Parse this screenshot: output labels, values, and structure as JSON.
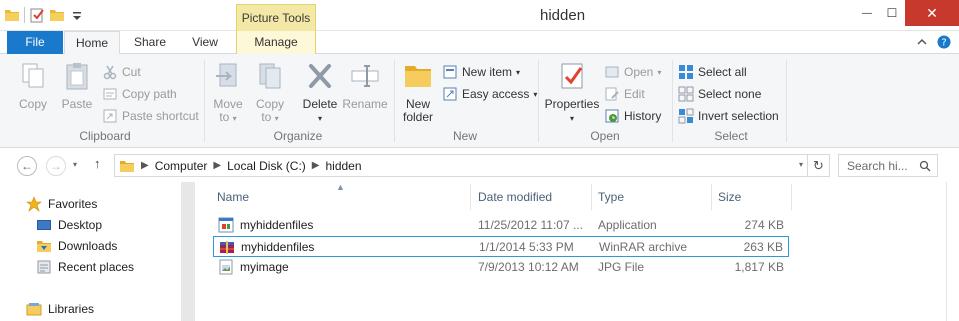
{
  "window": {
    "title": "hidden",
    "contextual_tab": "Picture Tools",
    "close_glyph": "✕",
    "minimize_glyph": "—",
    "maximize_glyph": "☐"
  },
  "tabs": {
    "file": "File",
    "home": "Home",
    "share": "Share",
    "view": "View",
    "manage": "Manage"
  },
  "ribbon": {
    "clipboard": {
      "label": "Clipboard",
      "copy": "Copy",
      "paste": "Paste",
      "cut": "Cut",
      "copy_path": "Copy path",
      "paste_shortcut": "Paste shortcut"
    },
    "organize": {
      "label": "Organize",
      "move_to_1": "Move",
      "move_to_2": "to",
      "copy_to_1": "Copy",
      "copy_to_2": "to",
      "delete": "Delete",
      "rename": "Rename"
    },
    "new": {
      "label": "New",
      "new_folder_1": "New",
      "new_folder_2": "folder",
      "new_item": "New item",
      "easy_access": "Easy access"
    },
    "open": {
      "label": "Open",
      "properties": "Properties",
      "open": "Open",
      "edit": "Edit",
      "history": "History"
    },
    "select": {
      "label": "Select",
      "select_all": "Select all",
      "select_none": "Select none",
      "invert_selection": "Invert selection"
    }
  },
  "address": {
    "segments": [
      "Computer",
      "Local Disk (C:)",
      "hidden"
    ],
    "search_placeholder": "Search hi..."
  },
  "navpane": {
    "favorites": "Favorites",
    "desktop": "Desktop",
    "downloads": "Downloads",
    "recent": "Recent places",
    "libraries": "Libraries"
  },
  "columns": {
    "name": "Name",
    "date": "Date modified",
    "type": "Type",
    "size": "Size"
  },
  "files": [
    {
      "name": "myhiddenfiles",
      "date": "11/25/2012 11:07 ...",
      "type": "Application",
      "size": "274 KB",
      "icon": "application-icon"
    },
    {
      "name": "myhiddenfiles",
      "date": "1/1/2014 5:33 PM",
      "type": "WinRAR archive",
      "size": "263 KB",
      "icon": "winrar-archive-icon"
    },
    {
      "name": "myimage",
      "date": "7/9/2013 10:12 AM",
      "type": "JPG File",
      "size": "1,817 KB",
      "icon": "image-file-icon"
    }
  ],
  "colors": {
    "file_tab": "#1979ca",
    "close_button": "#c7392c",
    "contextual_tab": "#f3e8a5",
    "selection_border": "#2d9ad8"
  }
}
